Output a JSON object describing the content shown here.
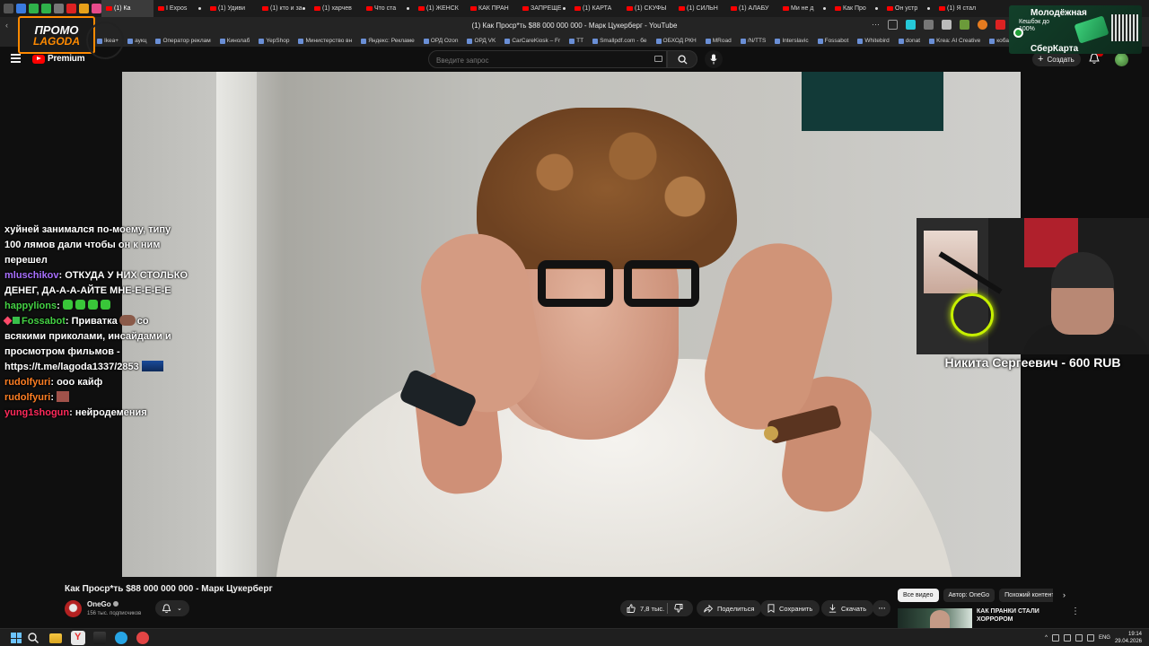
{
  "browser": {
    "window_title": "(1) Как Проср*ть $88 000 000 000 - Марк Цукерберг - YouTube",
    "tabs": [
      "(1) Ка",
      "I Expos",
      "(1) Удиви",
      "(1) кто и за",
      "(1) харчев",
      "Что ста",
      "(1) ЖЕНСК",
      "КАК ПРАН",
      "ЗАПРЕЩЕ",
      "(1) КАРТА",
      "(1) СКУФЫ",
      "(1) СИЛЬН",
      "(1) АЛАБУ",
      "Ми не д",
      "Как Про",
      "Он устр",
      "(1) Я стал"
    ],
    "bookmarks": [
      "Ikea+",
      "аукц",
      "Оператор реклам",
      "Кинолаб",
      "YepShop",
      "Министерство вн",
      "Яндекс: Рекламе",
      "ОРД Ozon",
      "ОРД VK",
      "CarCareKiosk – Fr",
      "TT",
      "Smallpdf.com - бе",
      "ОБХОД РКН",
      "MRoad",
      "/N/TTS",
      "Interslavic",
      "Fossabot",
      "Whitebird",
      "donat",
      "Krea: AI Creative",
      "кобаль"
    ]
  },
  "promo": {
    "line1": "ПРОМО",
    "line2": "LAGODA"
  },
  "bank_ad": {
    "line1": "Молодёжная",
    "line2": "Кешбэк до 100%",
    "line3": "СберКарта"
  },
  "youtube": {
    "logo_label": "Premium",
    "search_placeholder": "Введите запрос",
    "create_label": "Создать"
  },
  "chat": {
    "m1": "хуйней занимался по-моему, типу 100 лямов дали чтобы он к ним перешел",
    "m2_user": "mluschikov",
    "m2_text": ": ОТКУДА У НИХ СТОЛЬКО ДЕНЕГ, ДА-А-А-АЙТЕ МНЕ-Е-Е-Е-Е",
    "m3_user": "happylions",
    "m3_text": ":",
    "m4_user": "Fossabot",
    "m4_text_a": ": Приватка",
    "m4_text_b": "со всякими приколами, инсайдами и просмотром фильмов - https://t.me/lagoda1337/2853",
    "m5_user": "rudolfyuri",
    "m5_text": ": ооо кайф",
    "m6_user": "rudolfyuri",
    "m6_text": ":",
    "m7_user": "yung1shogun",
    "m7_text": ": нейродемения"
  },
  "donation_caption": "Никита Сергеевич - 600 RUB",
  "video": {
    "title": "Как Проср*ть $88 000 000 000 - Марк Цукерберг",
    "channel": "OneGo",
    "subscribers": "156 тыс. подписчиков",
    "likes": "7,8 тыс.",
    "share_label": "Поделиться",
    "save_label": "Сохранить",
    "download_label": "Скачать"
  },
  "recommendations": {
    "chips": [
      "Все видео",
      "Автор: OneGo",
      "Похожий контент"
    ],
    "first_title": "КАК ПРАНКИ СТАЛИ ХОРРОРОМ"
  },
  "taskbar": {
    "lang": "ENG",
    "time": "19:14",
    "date": "29.04.2026"
  },
  "colors": {
    "yt_red": "#ff0000",
    "chat_purple": "#a970ff",
    "chat_green": "#44d144",
    "chat_orange": "#ff7f24",
    "chat_red": "#ff2a5b",
    "promo_orange": "#ff8a00"
  },
  "icons": [
    "menu-icon",
    "search-icon",
    "mic-icon",
    "keyboard-icon",
    "bell-icon",
    "like-icon",
    "dislike-icon",
    "share-icon",
    "save-icon",
    "download-icon",
    "more-icon",
    "windows-start-icon"
  ]
}
